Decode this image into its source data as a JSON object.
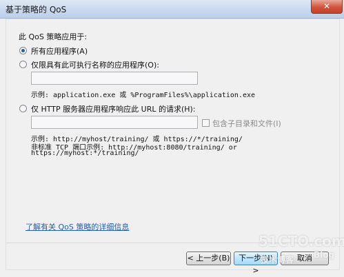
{
  "window": {
    "title": "基于策略的 QoS",
    "close_label": "✕"
  },
  "form": {
    "heading": "此 QoS 策略应用于:",
    "option_all": "所有应用程序(A)",
    "option_exe": "仅限具有此可执行名称的应用程序(O):",
    "exe_value": "",
    "exe_example": "示例:  application.exe 或 %ProgramFiles%\\application.exe",
    "option_http": "仅 HTTP 服务器应用程序响应此 URL 的请求(H):",
    "url_value": "",
    "include_subdirs": "包含子目录和文件(I)",
    "url_example_line1": "示例:  http://myhost/training/ 或 https://*/training/",
    "url_example_line2": "非标准 TCP 端口示例:  http://myhost:8080/training/ or",
    "url_example_line3": "https://myhost:*/training/",
    "learn_more": "了解有关 QoS 策略的详细信息"
  },
  "buttons": {
    "back": "< 上一步(B)",
    "next": "下一步(N) >",
    "cancel": "取消"
  },
  "selected_option": "option_all",
  "watermark": {
    "site": "51CTO.com",
    "blog": "技术博客",
    "blog_suffix": "Blog"
  },
  "colors": {
    "link": "#1f5fb5",
    "title_bar": "#c9d9ee",
    "close_button": "#d0533d"
  }
}
